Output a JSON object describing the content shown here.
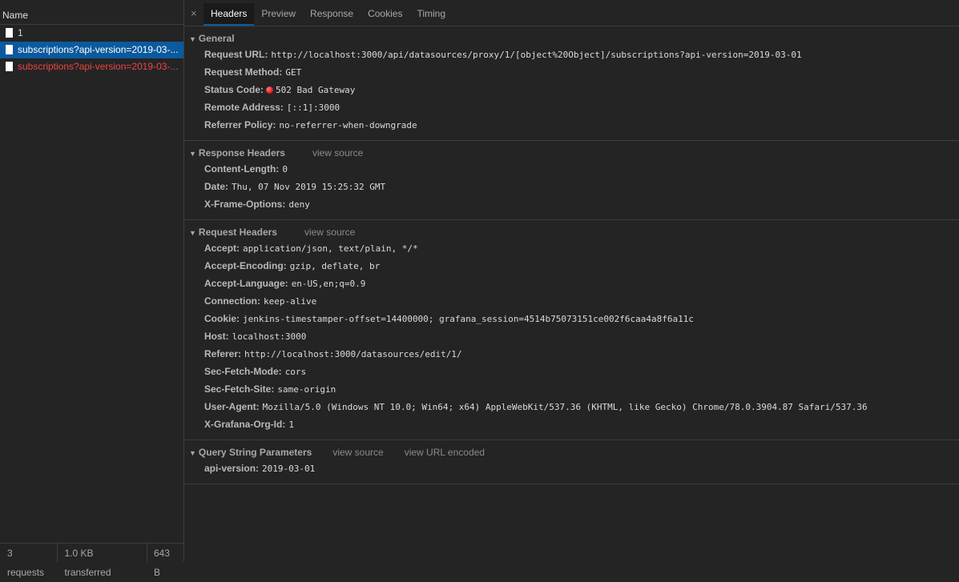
{
  "requests_panel": {
    "column_name": "Name",
    "rows": [
      {
        "name": "1",
        "state": "normal"
      },
      {
        "name": "subscriptions?api-version=2019-03-...",
        "state": "selected"
      },
      {
        "name": "subscriptions?api-version=2019-03-...",
        "state": "error"
      }
    ],
    "footer": {
      "count": "3 requests",
      "transferred": "1.0 KB transferred",
      "size": "643 B"
    }
  },
  "tabs": [
    "Headers",
    "Preview",
    "Response",
    "Cookies",
    "Timing"
  ],
  "active_tab": "Headers",
  "close_glyph": "×",
  "general": {
    "title": "General",
    "rows": [
      {
        "key": "Request URL:",
        "value": "http://localhost:3000/api/datasources/proxy/1/[object%20Object]/subscriptions?api-version=2019-03-01"
      },
      {
        "key": "Request Method:",
        "value": "GET"
      },
      {
        "key": "Status Code:",
        "value": "502 Bad Gateway",
        "status_color": "#e02020"
      },
      {
        "key": "Remote Address:",
        "value": "[::1]:3000"
      },
      {
        "key": "Referrer Policy:",
        "value": "no-referrer-when-downgrade"
      }
    ]
  },
  "response_headers": {
    "title": "Response Headers",
    "view_source": "view source",
    "rows": [
      {
        "key": "Content-Length:",
        "value": "0"
      },
      {
        "key": "Date:",
        "value": "Thu, 07 Nov 2019 15:25:32 GMT"
      },
      {
        "key": "X-Frame-Options:",
        "value": "deny"
      }
    ]
  },
  "request_headers": {
    "title": "Request Headers",
    "view_source": "view source",
    "rows": [
      {
        "key": "Accept:",
        "value": "application/json, text/plain, */*"
      },
      {
        "key": "Accept-Encoding:",
        "value": "gzip, deflate, br"
      },
      {
        "key": "Accept-Language:",
        "value": "en-US,en;q=0.9"
      },
      {
        "key": "Connection:",
        "value": "keep-alive"
      },
      {
        "key": "Cookie:",
        "value": "jenkins-timestamper-offset=14400000; grafana_session=4514b75073151ce002f6caa4a8f6a11c"
      },
      {
        "key": "Host:",
        "value": "localhost:3000"
      },
      {
        "key": "Referer:",
        "value": "http://localhost:3000/datasources/edit/1/"
      },
      {
        "key": "Sec-Fetch-Mode:",
        "value": "cors"
      },
      {
        "key": "Sec-Fetch-Site:",
        "value": "same-origin"
      },
      {
        "key": "User-Agent:",
        "value": "Mozilla/5.0 (Windows NT 10.0; Win64; x64) AppleWebKit/537.36 (KHTML, like Gecko) Chrome/78.0.3904.87 Safari/537.36"
      },
      {
        "key": "X-Grafana-Org-Id:",
        "value": "1"
      }
    ]
  },
  "query_params": {
    "title": "Query String Parameters",
    "view_source": "view source",
    "view_url_encoded": "view URL encoded",
    "rows": [
      {
        "key": "api-version:",
        "value": "2019-03-01"
      }
    ]
  }
}
